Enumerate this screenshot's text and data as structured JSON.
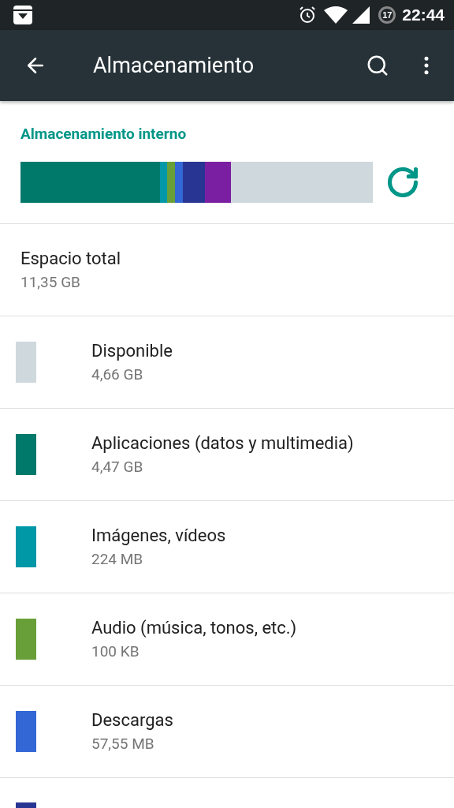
{
  "status_bar": {
    "time": "22:44",
    "notification_count": "17"
  },
  "toolbar": {
    "title": "Almacenamiento"
  },
  "section": {
    "title": "Almacenamiento interno"
  },
  "usage_bar": {
    "segments": [
      {
        "color": "#00796b"
      },
      {
        "color": "#0097a7"
      },
      {
        "color": "#689f38"
      },
      {
        "color": "#3367d6"
      },
      {
        "color": "#283593"
      },
      {
        "color": "#7b1fa2"
      },
      {
        "color": "#cfd8dc"
      }
    ]
  },
  "total": {
    "title": "Espacio total",
    "value": "11,35 GB"
  },
  "categories": [
    {
      "color": "#cfd8dc",
      "title": "Disponible",
      "value": "4,66 GB"
    },
    {
      "color": "#00796b",
      "title": "Aplicaciones (datos y multimedia)",
      "value": "4,47 GB"
    },
    {
      "color": "#0097a7",
      "title": "Imágenes, vídeos",
      "value": "224 MB"
    },
    {
      "color": "#689f38",
      "title": "Audio (música, tonos, etc.)",
      "value": "100 KB"
    },
    {
      "color": "#3367d6",
      "title": "Descargas",
      "value": "57,55 MB"
    },
    {
      "color": "#283593"
    }
  ]
}
